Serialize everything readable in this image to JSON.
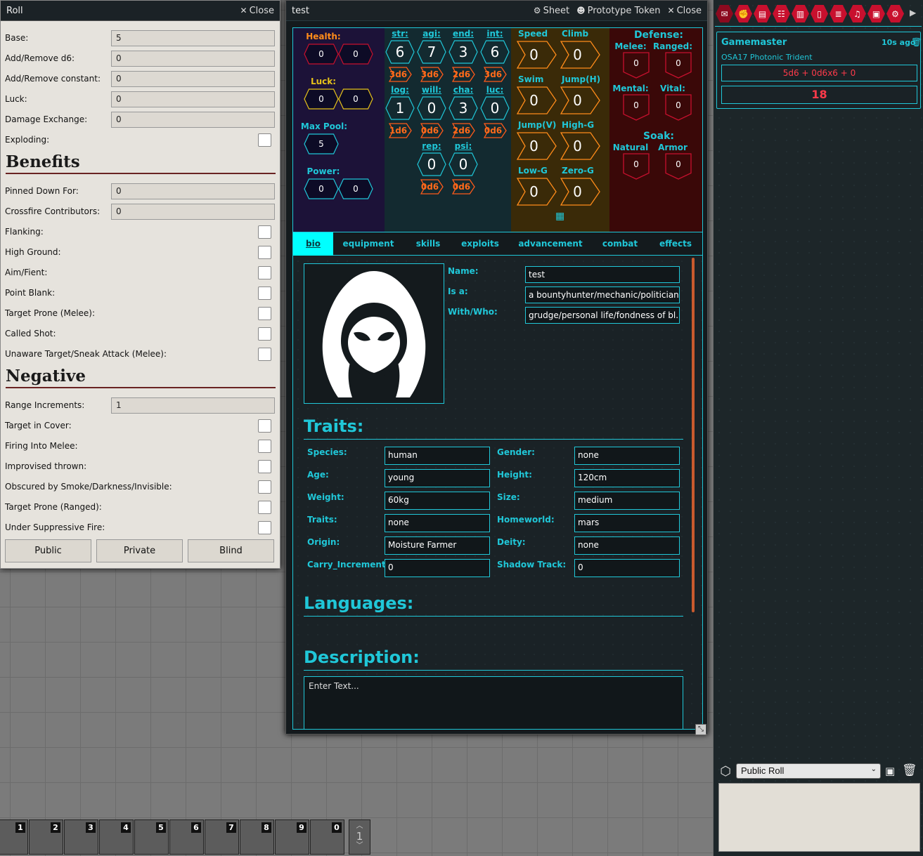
{
  "roll": {
    "title": "Roll",
    "close": "Close",
    "fields": [
      {
        "label": "Base:",
        "value": "5",
        "type": "input"
      },
      {
        "label": "Add/Remove d6:",
        "value": "0",
        "type": "input"
      },
      {
        "label": "Add/Remove constant:",
        "value": "0",
        "type": "input"
      },
      {
        "label": "Luck:",
        "value": "0",
        "type": "input"
      },
      {
        "label": "Damage Exchange:",
        "value": "0",
        "type": "input"
      },
      {
        "label": "Exploding:",
        "type": "checkbox"
      }
    ],
    "benefits_title": "Benefits",
    "benefits": [
      {
        "label": "Pinned Down For:",
        "value": "0",
        "type": "input"
      },
      {
        "label": "Crossfire Contributors:",
        "value": "0",
        "type": "input"
      },
      {
        "label": "Flanking:",
        "type": "checkbox"
      },
      {
        "label": "High Ground:",
        "type": "checkbox"
      },
      {
        "label": "Aim/Fient:",
        "type": "checkbox"
      },
      {
        "label": "Point Blank:",
        "type": "checkbox"
      },
      {
        "label": "Target Prone (Melee):",
        "type": "checkbox"
      },
      {
        "label": "Called Shot:",
        "type": "checkbox"
      },
      {
        "label": "Unaware Target/Sneak Attack (Melee):",
        "type": "checkbox"
      }
    ],
    "negative_title": "Negative",
    "negative": [
      {
        "label": "Range Increments:",
        "value": "1",
        "type": "input"
      },
      {
        "label": "Target in Cover:",
        "type": "checkbox"
      },
      {
        "label": "Firing Into Melee:",
        "type": "checkbox"
      },
      {
        "label": "Improvised thrown:",
        "type": "checkbox"
      },
      {
        "label": "Obscured by Smoke/Darkness/Invisible:",
        "type": "checkbox"
      },
      {
        "label": "Target Prone (Ranged):",
        "type": "checkbox"
      },
      {
        "label": "Under Suppressive Fire:",
        "type": "checkbox"
      }
    ],
    "buttons": [
      "Public",
      "Private",
      "Blind"
    ]
  },
  "sheet": {
    "title": "test",
    "header_buttons": {
      "sheet": "Sheet",
      "token": "Prototype Token",
      "close": "Close"
    },
    "vitals": {
      "health_label": "Health:",
      "health": [
        "0",
        "0"
      ],
      "luck_label": "Luck:",
      "luck": [
        "0",
        "0"
      ],
      "maxpool_label": "Max Pool:",
      "maxpool": "5",
      "power_label": "Power:",
      "power": [
        "0",
        "0"
      ]
    },
    "attributes": [
      {
        "label": "str:",
        "value": "6",
        "dice": "3d6"
      },
      {
        "label": "agi:",
        "value": "7",
        "dice": "3d6"
      },
      {
        "label": "end:",
        "value": "3",
        "dice": "2d6"
      },
      {
        "label": "int:",
        "value": "6",
        "dice": "3d6"
      },
      {
        "label": "log:",
        "value": "1",
        "dice": "1d6"
      },
      {
        "label": "will:",
        "value": "0",
        "dice": "0d6"
      },
      {
        "label": "cha:",
        "value": "3",
        "dice": "2d6"
      },
      {
        "label": "luc:",
        "value": "0",
        "dice": "0d6"
      },
      {
        "label": "rep:",
        "value": "0",
        "dice": "0d6"
      },
      {
        "label": "psi:",
        "value": "0",
        "dice": "0d6"
      }
    ],
    "movement": [
      {
        "label": "Speed",
        "value": "0"
      },
      {
        "label": "Climb",
        "value": "0"
      },
      {
        "label": "Swim",
        "value": "0"
      },
      {
        "label": "Jump(H)",
        "value": "0"
      },
      {
        "label": "Jump(V)",
        "value": "0"
      },
      {
        "label": "High-G",
        "value": "0"
      },
      {
        "label": "Low-G",
        "value": "0"
      },
      {
        "label": "Zero-G",
        "value": "0"
      }
    ],
    "defense": {
      "title": "Defense:",
      "items": [
        {
          "label": "Melee:",
          "value": "0"
        },
        {
          "label": "Ranged:",
          "value": "0"
        },
        {
          "label": "Mental:",
          "value": "0"
        },
        {
          "label": "Vital:",
          "value": "0"
        }
      ],
      "soak_title": "Soak:",
      "soak": [
        {
          "label": "Natural",
          "value": "0"
        },
        {
          "label": "Armor",
          "value": "0"
        }
      ]
    },
    "tabs": [
      "bio",
      "equipment",
      "skills",
      "exploits",
      "advancement",
      "combat",
      "effects"
    ],
    "bio": {
      "name_label": "Name:",
      "name": "test",
      "isa_label": "Is a:",
      "isa": "a bountyhunter/mechanic/politician",
      "with_label": "With/Who:",
      "with": "grudge/personal life/fondness of bl..."
    },
    "traits_title": "Traits:",
    "traits": [
      {
        "label": "Species:",
        "value": "human"
      },
      {
        "label": "Gender:",
        "value": "none"
      },
      {
        "label": "Age:",
        "value": "young"
      },
      {
        "label": "Height:",
        "value": "120cm"
      },
      {
        "label": "Weight:",
        "value": "60kg"
      },
      {
        "label": "Size:",
        "value": "medium"
      },
      {
        "label": "Traits:",
        "value": "none"
      },
      {
        "label": "Homeworld:",
        "value": "mars"
      },
      {
        "label": "Origin:",
        "value": "Moisture Farmer"
      },
      {
        "label": "Deity:",
        "value": "none"
      },
      {
        "label": "Carry_Increment:",
        "value": "0"
      },
      {
        "label": "Shadow Track:",
        "value": "0"
      }
    ],
    "languages_title": "Languages:",
    "description_title": "Description:",
    "description_placeholder": "Enter Text..."
  },
  "chat": {
    "sender": "Gamemaster",
    "time": "10s ago",
    "flavor": "OSA17 Photonic Trident",
    "formula": "5d6 + 0d6x6 + 0",
    "total": "18",
    "roll_mode": "Public Roll"
  },
  "sidebar_tabs": [
    "chat-icon",
    "combat-icon",
    "scenes-icon",
    "actors-icon",
    "items-icon",
    "journal-icon",
    "tables-icon",
    "playlists-icon",
    "compendium-icon",
    "settings-icon"
  ],
  "hotbar": {
    "slots": [
      "1",
      "2",
      "3",
      "4",
      "5",
      "6",
      "7",
      "8",
      "9",
      "0"
    ],
    "page": "1"
  },
  "colors": {
    "accent": "#20c7d8",
    "red": "#c8102e",
    "orange": "#ff8c1a",
    "gold": "#e6c21a"
  }
}
